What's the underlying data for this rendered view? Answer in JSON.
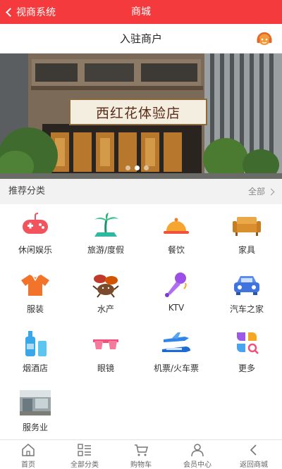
{
  "topbar": {
    "back_label": "视商系统",
    "title": "商城"
  },
  "subhead": {
    "title": "入驻商户",
    "service_icon": "customer-service-icon"
  },
  "banner": {
    "sign_text": "西红花体验店",
    "slides": 3,
    "active_slide": 2
  },
  "section": {
    "title": "推荐分类",
    "all_label": "全部"
  },
  "categories": [
    {
      "label": "休闲娱乐",
      "icon": "gamepad-icon"
    },
    {
      "label": "旅游/度假",
      "icon": "palm-tree-icon"
    },
    {
      "label": "餐饮",
      "icon": "food-cloche-icon"
    },
    {
      "label": "家具",
      "icon": "sofa-icon"
    },
    {
      "label": "服装",
      "icon": "shirt-icon"
    },
    {
      "label": "水产",
      "icon": "seafood-icon"
    },
    {
      "label": "KTV",
      "icon": "microphone-icon"
    },
    {
      "label": "汽车之家",
      "icon": "car-icon"
    },
    {
      "label": "烟酒店",
      "icon": "bottle-icon"
    },
    {
      "label": "眼镜",
      "icon": "glasses-icon"
    },
    {
      "label": "机票/火车票",
      "icon": "plane-train-icon"
    },
    {
      "label": "更多",
      "icon": "more-apps-icon"
    },
    {
      "label": "服务业",
      "icon": "service-photo-icon"
    }
  ],
  "tabbar": [
    {
      "label": "首页",
      "icon": "home-icon"
    },
    {
      "label": "全部分类",
      "icon": "category-grid-icon"
    },
    {
      "label": "购物车",
      "icon": "cart-icon"
    },
    {
      "label": "会员中心",
      "icon": "user-icon"
    },
    {
      "label": "返回商城",
      "icon": "back-arrow-icon"
    }
  ],
  "colors": {
    "brand": "#f43a3c",
    "background": "#f2f2f2"
  }
}
